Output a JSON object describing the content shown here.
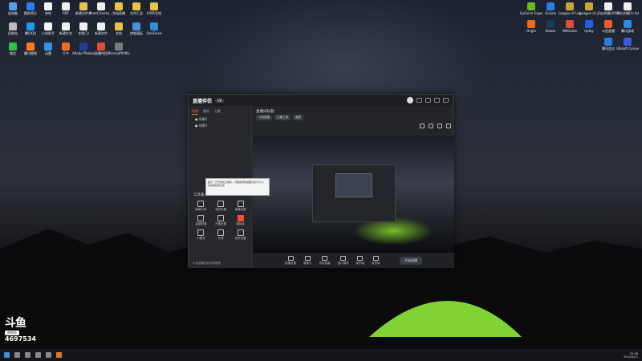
{
  "desktop": {
    "icons_left": [
      {
        "label": "此电脑",
        "color": "#5aa0e6"
      },
      {
        "label": "酷狗音乐",
        "color": "#2b7de9"
      },
      {
        "label": "哈哈",
        "color": "#f0f0f0"
      },
      {
        "label": "PDF",
        "color": "#f0f0f0"
      },
      {
        "label": "新建文件夹",
        "color": "#e8c24a"
      },
      {
        "label": "PureCharms...",
        "color": "#f0f0f0"
      },
      {
        "label": "文档直播",
        "color": "#e8c24a"
      },
      {
        "label": "文件汇总",
        "color": "#e8c24a"
      },
      {
        "label": "4595文档",
        "color": "#e8c24a"
      },
      {
        "label": "回收站",
        "color": "#bbbbbb"
      },
      {
        "label": "腾讯QQ",
        "color": "#1e9be6"
      },
      {
        "label": "小米助手",
        "color": "#f5f5f5"
      },
      {
        "label": "新建文本",
        "color": "#f0f0f0"
      },
      {
        "label": "文档(1)",
        "color": "#f0f0f0"
      },
      {
        "label": "新建文件",
        "color": "#f0f0f0"
      },
      {
        "label": "文档",
        "color": "#e8c24a"
      },
      {
        "label": "控制面板",
        "color": "#4a8fe0"
      },
      {
        "label": "OneDrive",
        "color": "#2d8de0"
      },
      {
        "label": "微信",
        "color": "#2fbf4a"
      },
      {
        "label": "腾讯视频",
        "color": "#ff7a1a"
      },
      {
        "label": "迅雷",
        "color": "#3a8fe6"
      },
      {
        "label": "千牛",
        "color": "#f06a2a"
      },
      {
        "label": "Adobe Photosh...",
        "color": "#1f3e8f"
      },
      {
        "label": "直播伴侣",
        "color": "#e04a3a"
      },
      {
        "label": "MicrosoftOfficePro",
        "color": "#7a7a7a"
      }
    ],
    "icons_right": [
      {
        "label": "开启关播(1).txt",
        "color": "#f0f0f0"
      },
      {
        "label": "开启关播(2019...",
        "color": "#f0f0f0"
      },
      {
        "label": "League of...",
        "color": "#c8a43a"
      },
      {
        "label": "League of Legends",
        "color": "#c8a43a"
      },
      {
        "label": "GoLink",
        "color": "#2a7ee0"
      },
      {
        "label": "GeForce Experience",
        "color": "#6ab82a"
      },
      {
        "label": "腾讯游戏",
        "color": "#2a8ae0"
      },
      {
        "label": "斗鱼直播",
        "color": "#f05a2a"
      },
      {
        "label": "Uplay",
        "color": "#2a5ae0"
      },
      {
        "label": "WeGame",
        "color": "#e04a3a"
      },
      {
        "label": "Steam",
        "color": "#1a3a5a"
      },
      {
        "label": "Origin",
        "color": "#f06a1a"
      },
      {
        "label": "Ubisoft Connect",
        "color": "#3a5ae0"
      },
      {
        "label": "腾讯会议",
        "color": "#2a7ae0"
      }
    ]
  },
  "app": {
    "logo": "直播伴侣",
    "version": "V6",
    "left_tabs": [
      "场景",
      "素材",
      "元素"
    ],
    "scenes": [
      "● 场景1",
      "● 场景2"
    ],
    "tools_title": "工具箱",
    "tools": [
      "屏幕共享",
      "录制设置",
      "直播设置",
      "高级配置",
      "开播设置",
      "模板库",
      "小程序",
      "礼物",
      "更多设置"
    ],
    "bottom_note": "斗鱼直播伴侣使用教程",
    "room_title": "直播间标题",
    "chips": [
      "斗鱼直播",
      "主播工具",
      "画质"
    ],
    "controls": [
      "直播设置",
      "摄像头",
      "游戏直播",
      "窗口捕获",
      "画中画",
      "麦克风"
    ],
    "start_button": "开始直播",
    "tooltip": "提示：已开启窗口捕获，可拖拽调整画面位置与大小，双击编辑源设置"
  },
  "overlay": {
    "brand": "斗鱼",
    "room_label": "房间号",
    "room_number": "4697534"
  },
  "taskbar": {
    "time": "22:06",
    "date": "2022/4/11"
  }
}
